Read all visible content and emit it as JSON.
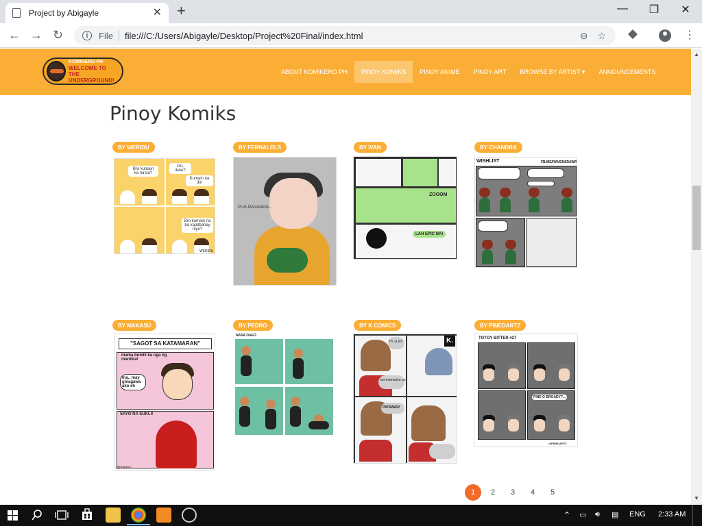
{
  "browser": {
    "tab_title": "Project by Abigayle",
    "tab_close": "✕",
    "new_tab": "+",
    "minimize": "—",
    "maximize": "❐",
    "close": "✕",
    "back": "←",
    "forward": "→",
    "reload": "↻",
    "scheme_label": "File",
    "url": "file:///C:/Users/Abigayle/Desktop/Project%20Final/index.html",
    "zoom_icon": "⊖",
    "bookmark_icon": "☆",
    "menu_icon": "⋮"
  },
  "site": {
    "logo": {
      "line1": "KOMIKERO PH",
      "line2": "WELCOME TO",
      "line3": "THE UNDERGROUND!"
    },
    "nav": [
      {
        "label": "ABOUT KOMIKERO PH",
        "active": false
      },
      {
        "label": "PINOY KOMIKS",
        "active": true
      },
      {
        "label": "PINOY ANIME",
        "active": false
      },
      {
        "label": "PINOY ART",
        "active": false
      },
      {
        "label": "BROWSE BY ARTIST ▾",
        "active": false
      },
      {
        "label": "ANNOUNCEMENTS",
        "active": false
      }
    ],
    "colors": {
      "nav_bg": "#fbae35",
      "badge": "#fbae35",
      "pagination_active": "#f26b2a"
    }
  },
  "page": {
    "title": "Pinoy Komiks",
    "cards": [
      {
        "badge": "BY WERIDU",
        "texts": [
          "Bro kumain ka na ba?",
          "Oo, ikaw?",
          "Kumain na din",
          "Bro kumain na ba kapitbahay niyo?",
          "WERIDU"
        ]
      },
      {
        "badge": "BY FERNALOLS",
        "texts": [
          "PUG NANAMAN..."
        ]
      },
      {
        "badge": "BY IVAN",
        "texts": [
          "ZOOOM",
          "LAH EPIC NA!"
        ]
      },
      {
        "badge": "BY CHANDRA",
        "texts": [
          "WISHLIST",
          "FB.ME/RAVENSRAWR"
        ]
      },
      {
        "badge": "BY MAKASU",
        "texts": [
          "\"SAGOT SA KATAMARAN\"",
          "mama bumili ka nga ng mantika!",
          "ma.. may ginagawa ako eh",
          "SAYO NA SUKLI!",
          "@makasu"
        ]
      },
      {
        "badge": "BY PEDRO",
        "texts": [
          "NASA DuGO"
        ]
      },
      {
        "badge": "BY K COMICS",
        "texts": [
          "Hi, ui ko!",
          "ma-mamaoko po!",
          "PATAWAD!",
          "K."
        ]
      },
      {
        "badge": "BY PINEDARTZ",
        "texts": [
          "TOTOY BITTER #27",
          "PINE O BROADY?...",
          "@PINEDARTZ"
        ]
      }
    ],
    "pagination": [
      {
        "label": "1",
        "active": true
      },
      {
        "label": "2",
        "active": false
      },
      {
        "label": "3",
        "active": false
      },
      {
        "label": "4",
        "active": false
      },
      {
        "label": "5",
        "active": false
      }
    ]
  },
  "taskbar": {
    "language": "ENG",
    "time": "2:33 AM"
  }
}
